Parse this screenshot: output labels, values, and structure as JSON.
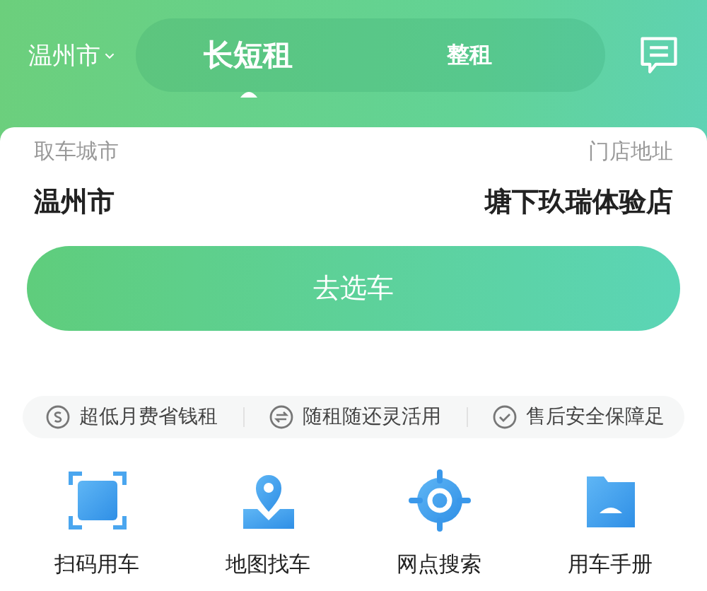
{
  "header": {
    "city": "温州市",
    "tabs": [
      {
        "label": "长短租",
        "selected": true
      },
      {
        "label": "整租",
        "selected": false
      }
    ]
  },
  "form": {
    "fields": [
      {
        "label": "取车城市",
        "value": "温州市"
      },
      {
        "label": "门店地址",
        "value": "塘下玖瑞体验店"
      }
    ]
  },
  "primary_button": "去选车",
  "features": [
    "超低月费省钱租",
    "随租随还灵活用",
    "售后安全保障足"
  ],
  "shortcuts": [
    "扫码用车",
    "地图找车",
    "网点搜索",
    "用车手册"
  ]
}
